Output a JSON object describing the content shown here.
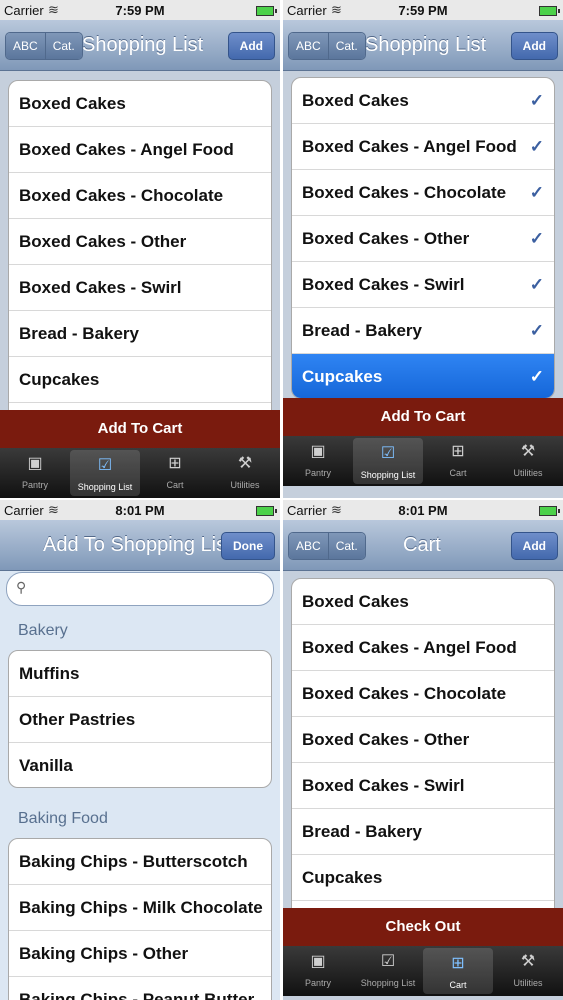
{
  "colors": {
    "nav_tint": "#7f98b8",
    "action_bar": "#7a1b0e",
    "selection": "#1566d8",
    "check": "#3b5fa0"
  },
  "screens": [
    {
      "status": {
        "carrier": "Carrier",
        "time": "7:59 PM"
      },
      "nav": {
        "seg": [
          "ABC",
          "Cat."
        ],
        "title": "Shopping List",
        "right": "Add"
      },
      "rows": [
        {
          "label": "Boxed Cakes"
        },
        {
          "label": "Boxed Cakes - Angel Food"
        },
        {
          "label": "Boxed Cakes - Chocolate"
        },
        {
          "label": "Boxed Cakes - Other"
        },
        {
          "label": "Boxed Cakes - Swirl"
        },
        {
          "label": "Bread - Bakery"
        },
        {
          "label": "Cupcakes"
        }
      ],
      "action": "Add To Cart",
      "tabs": [
        "Pantry",
        "Shopping List",
        "Cart",
        "Utilities"
      ],
      "active_tab": "Shopping List"
    },
    {
      "status": {
        "carrier": "Carrier",
        "time": "7:59 PM"
      },
      "nav": {
        "seg": [
          "ABC",
          "Cat."
        ],
        "title": "Shopping List",
        "right": "Add"
      },
      "rows": [
        {
          "label": "Boxed Cakes",
          "check": "✓"
        },
        {
          "label": "Boxed Cakes - Angel Food",
          "check": "✓"
        },
        {
          "label": "Boxed Cakes - Chocolate",
          "check": "✓"
        },
        {
          "label": "Boxed Cakes - Other",
          "check": "✓"
        },
        {
          "label": "Boxed Cakes - Swirl",
          "check": "✓"
        },
        {
          "label": "Bread - Bakery",
          "check": "✓"
        },
        {
          "label": "Cupcakes",
          "check": "✓",
          "selected": true
        }
      ],
      "action": "Add To Cart",
      "tabs": [
        "Pantry",
        "Shopping List",
        "Cart",
        "Utilities"
      ],
      "active_tab": "Shopping List"
    },
    {
      "status": {
        "carrier": "Carrier",
        "time": "8:01 PM"
      },
      "nav": {
        "title": "Add To Shopping List",
        "right": "Done"
      },
      "search": {
        "placeholder": ""
      },
      "sections": [
        {
          "title": "Bakery",
          "rows": [
            "Muffins",
            "Other Pastries",
            "Vanilla"
          ]
        },
        {
          "title": "Baking Food",
          "rows": [
            "Baking Chips - Butterscotch",
            "Baking Chips - Milk Chocolate",
            "Baking Chips - Other",
            "Baking Chips - Peanut Butter"
          ]
        }
      ]
    },
    {
      "status": {
        "carrier": "Carrier",
        "time": "8:01 PM"
      },
      "nav": {
        "seg": [
          "ABC",
          "Cat."
        ],
        "title": "Cart",
        "right": "Add"
      },
      "rows": [
        {
          "label": "Boxed Cakes"
        },
        {
          "label": "Boxed Cakes - Angel Food"
        },
        {
          "label": "Boxed Cakes - Chocolate"
        },
        {
          "label": "Boxed Cakes - Other"
        },
        {
          "label": "Boxed Cakes - Swirl"
        },
        {
          "label": "Bread - Bakery"
        },
        {
          "label": "Cupcakes"
        }
      ],
      "action": "Check Out",
      "tabs": [
        "Pantry",
        "Shopping List",
        "Cart",
        "Utilities"
      ],
      "active_tab": "Cart"
    }
  ]
}
